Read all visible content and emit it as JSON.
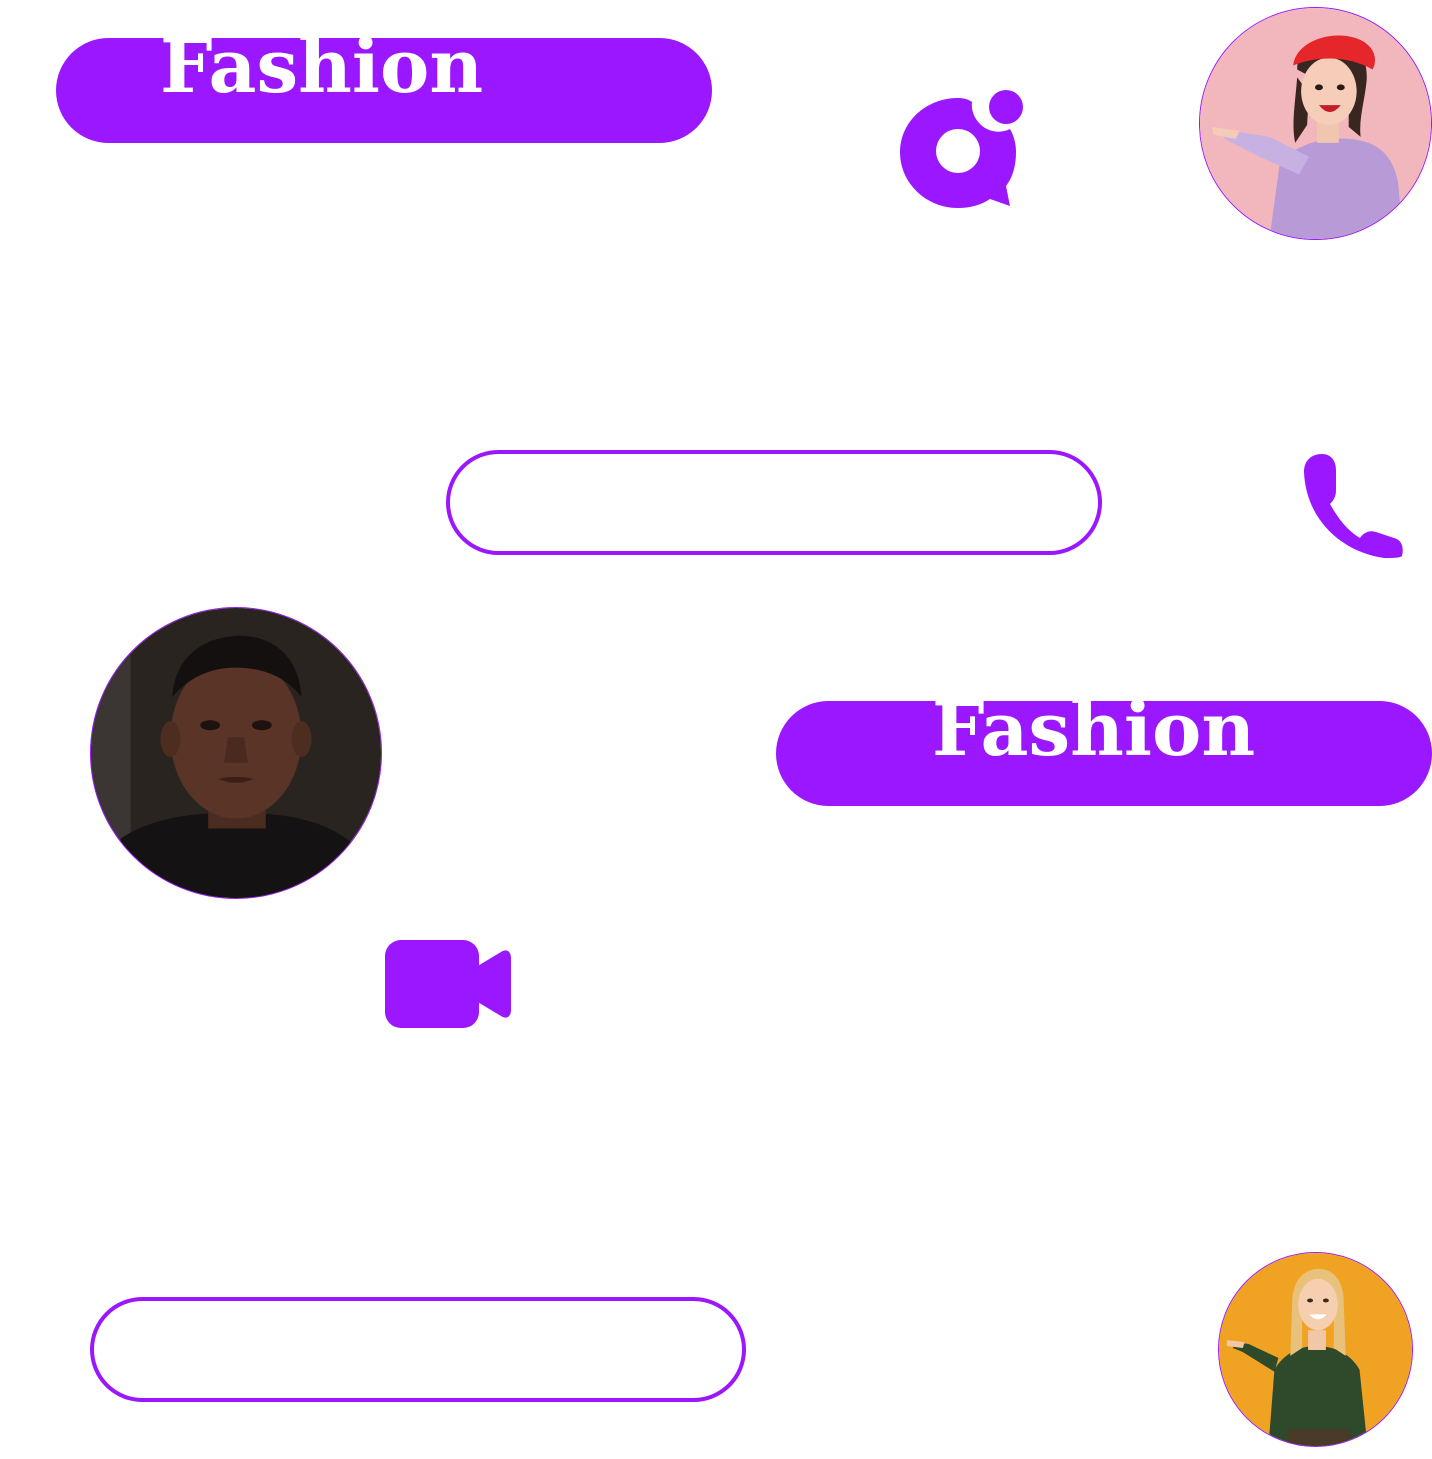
{
  "brand": {
    "accent_color": "#9a17ff",
    "text_on_accent": "#ffffff"
  },
  "pills": [
    {
      "style": "filled",
      "label": "Fashion"
    },
    {
      "style": "outline",
      "label": ""
    },
    {
      "style": "filled",
      "label": "Fashion"
    },
    {
      "style": "outline",
      "label": ""
    }
  ],
  "icons": [
    {
      "name": "chat-bubble-icon"
    },
    {
      "name": "phone-icon"
    },
    {
      "name": "video-camera-icon"
    }
  ],
  "avatars": [
    {
      "name": "woman-red-beret-photo"
    },
    {
      "name": "man-portrait-photo"
    },
    {
      "name": "woman-green-sweater-photo"
    }
  ]
}
